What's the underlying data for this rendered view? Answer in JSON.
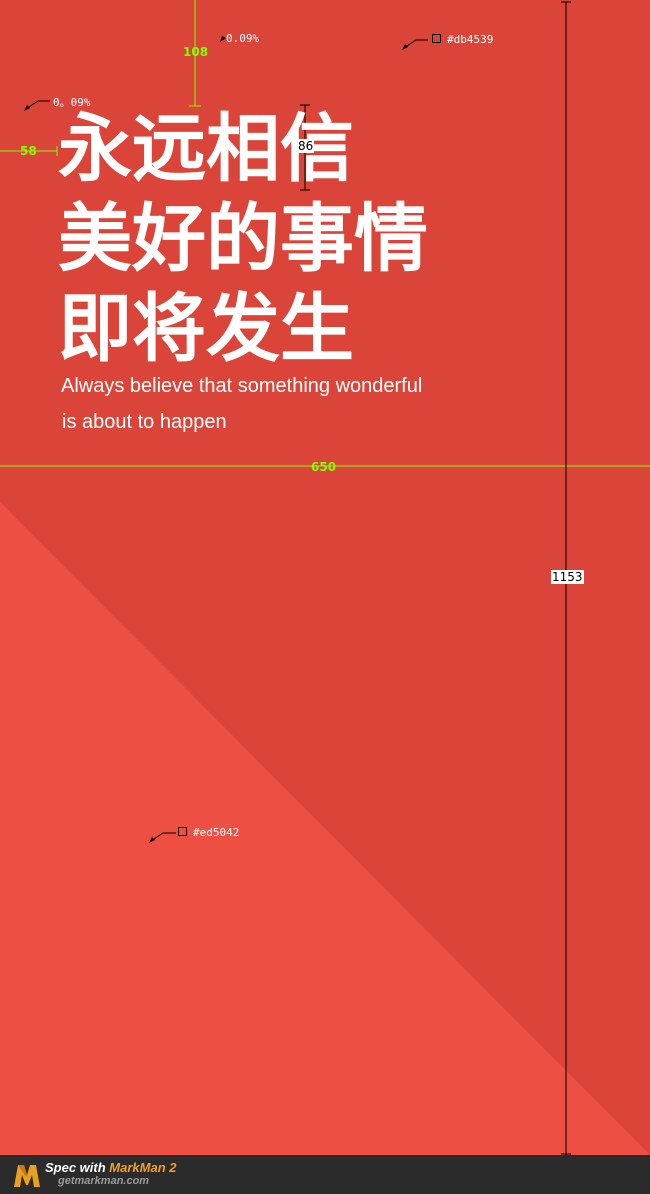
{
  "poster": {
    "headline_lines": [
      "永远相信",
      "美好的事情",
      "即将发生"
    ],
    "subtitle_lines": [
      "Always believe that something wonderful",
      "is about to happen"
    ],
    "colors": {
      "background": "#db4539",
      "triangle": "#ed5042",
      "text": "#ffffff"
    }
  },
  "spec": {
    "top_margin": "108",
    "left_margin": "58",
    "line_height": "86",
    "width": "650",
    "height": "1153",
    "opacity_1": "0.09%",
    "opacity_2": "0。09%",
    "color_bg": "#db4539",
    "color_triangle": "#ed5042",
    "line_color": "#7fff00"
  },
  "footer": {
    "spec_with": "Spec with ",
    "brand": "MarkMan 2",
    "url": "getmarkman.com",
    "logo_icon": "markman-logo-icon"
  }
}
